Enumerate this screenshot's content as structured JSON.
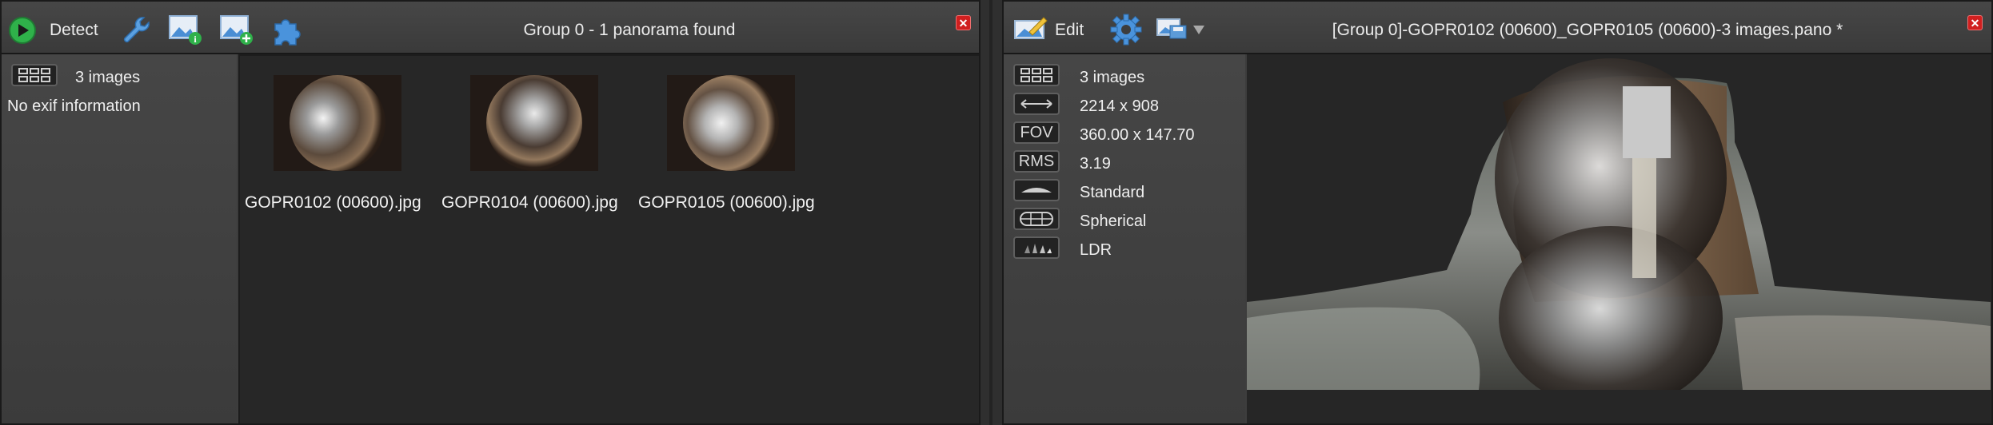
{
  "left_panel": {
    "toolbar": {
      "detect_label": "Detect",
      "title": "Group 0 - 1 panorama found"
    },
    "info": {
      "image_count": "3 images",
      "exif": "No exif information"
    },
    "thumbnails": [
      {
        "name": "GOPR0102 (00600).jpg"
      },
      {
        "name": "GOPR0104 (00600).jpg"
      },
      {
        "name": "GOPR0105 (00600).jpg"
      }
    ]
  },
  "right_panel": {
    "toolbar": {
      "edit_label": "Edit",
      "title": "[Group 0]-GOPR0102 (00600)_GOPR0105 (00600)-3 images.pano *"
    },
    "info": {
      "image_count": "3 images",
      "dimensions": "2214 x 908",
      "fov_badge": "FOV",
      "fov": "360.00 x 147.70",
      "rms_badge": "RMS",
      "rms": "3.19",
      "quality": "Standard",
      "projection": "Spherical",
      "range": "LDR"
    }
  },
  "icons": {
    "detect": "play-icon",
    "settings": "wrench-icon",
    "image_info": "image-info-icon",
    "add_image": "add-image-icon",
    "plugin": "puzzle-icon",
    "edit": "edit-icon",
    "gear": "gear-icon",
    "export": "export-icon",
    "close": "close-icon"
  },
  "colors": {
    "accent_green": "#2fb14a",
    "close_red": "#d01f1f",
    "icon_blue": "#3c86d1"
  }
}
